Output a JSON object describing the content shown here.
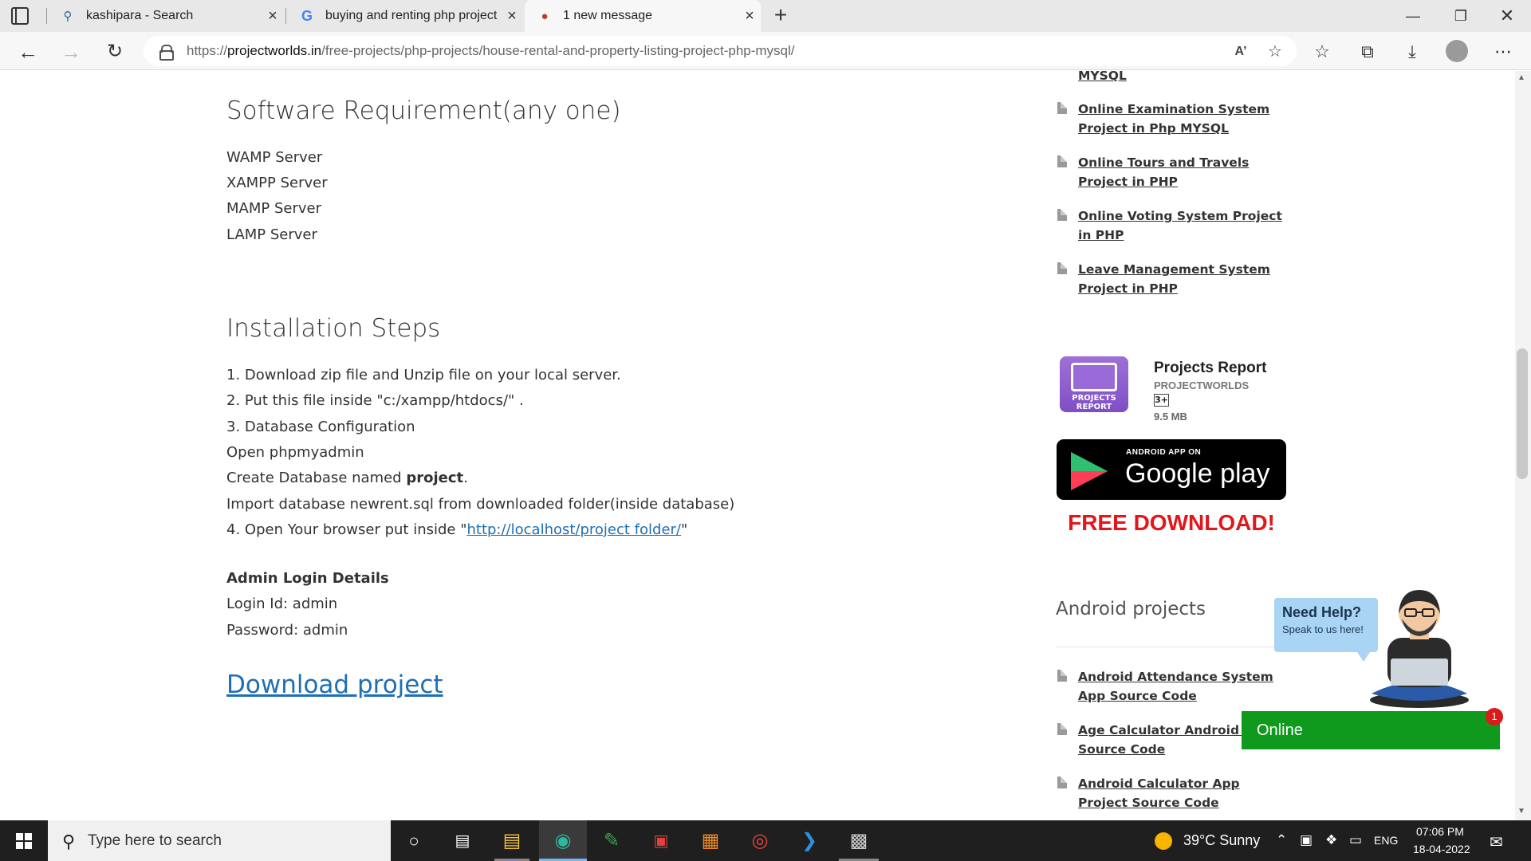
{
  "browser": {
    "tabs": [
      {
        "title": "kashipara - Search",
        "icon": "search-icon"
      },
      {
        "title": "buying and renting php project",
        "icon": "google-icon"
      },
      {
        "title": "1 new message",
        "icon": "site-icon"
      }
    ],
    "url_prefix": "https://",
    "url_host": "projectworlds.in",
    "url_path": "/free-projects/php-projects/house-rental-and-property-listing-project-php-mysql/"
  },
  "main": {
    "software_heading": "Software Requirement(any one)",
    "software_items": [
      "WAMP Server",
      "XAMPP Server",
      "MAMP Server",
      "LAMP Server"
    ],
    "install_heading": "Installation Steps",
    "steps": {
      "s1": "1. Download zip file and Unzip file on your local server.",
      "s2": "2. Put this file inside \"c:/xampp/htdocs/\" .",
      "s3": "3. Database Configuration",
      "s4": "Open phpmyadmin",
      "s5_pre": "Create Database named ",
      "s5_bold": "project",
      "s5_post": ".",
      "s6": "Import database newrent.sql from downloaded folder(inside database)",
      "s7_pre": "4. Open Your browser put inside \"",
      "s7_link": "http://localhost/project folder/",
      "s7_post": "\""
    },
    "admin_heading": "Admin Login Details",
    "login_id": "Login Id: admin",
    "password": "Password: admin",
    "download_link": "Download project"
  },
  "sidebar": {
    "top_items": [
      "MYSQL",
      "Online Examination System Project in Php MYSQL",
      "Online Tours and Travels Project in PHP",
      "Online Voting System Project in PHP",
      "Leave Management System Project in PHP"
    ],
    "app": {
      "icon_text": "PROJECTS REPORT",
      "name": "Projects Report",
      "developer": "PROJECTWORLDS",
      "rating": "3+",
      "size": "9.5 MB"
    },
    "gplay_small": "ANDROID APP ON",
    "gplay_big": "Google play",
    "free_download": "FREE DOWNLOAD!",
    "android_heading": "Android projects",
    "android_items": [
      "Android Attendance System App Source Code",
      "Age Calculator Android With Source Code",
      "Android Calculator App Project Source Code"
    ]
  },
  "chat": {
    "title": "Need Help?",
    "subtitle": "Speak to us here!",
    "status": "Online",
    "badge": "1"
  },
  "taskbar": {
    "search_placeholder": "Type here to search",
    "weather": "39°C  Sunny",
    "language": "ENG",
    "time": "07:06 PM",
    "date": "18-04-2022"
  },
  "colors": {
    "link": "#1f6fb5",
    "free_download": "#e3161b",
    "chat_online": "#0f9a1d"
  }
}
